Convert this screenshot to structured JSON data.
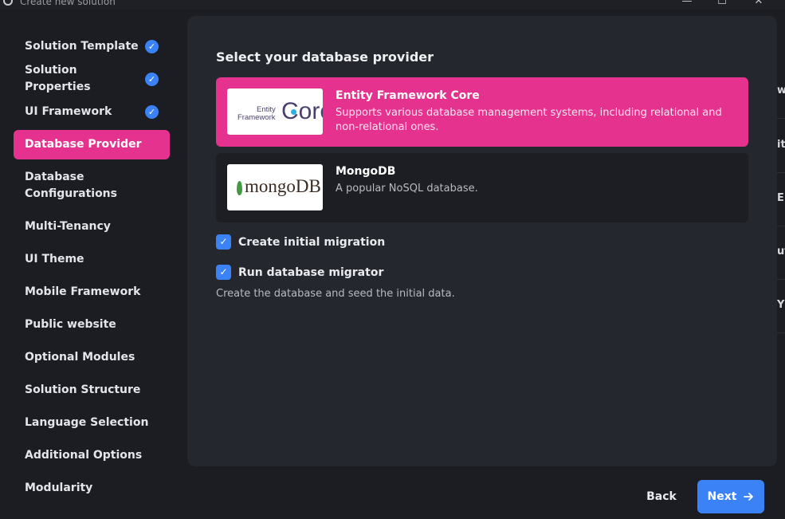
{
  "window": {
    "title": "Create new solution",
    "controls": {
      "minimize": "—",
      "maximize": "☐",
      "close": "✕"
    }
  },
  "sidebar": {
    "items": [
      {
        "label": "Solution Template",
        "completed": true
      },
      {
        "label": "Solution Properties",
        "completed": true
      },
      {
        "label": "UI Framework",
        "completed": true
      },
      {
        "label": "Database Provider",
        "active": true
      },
      {
        "label": "Database Configurations"
      },
      {
        "label": "Multi-Tenancy"
      },
      {
        "label": "UI Theme"
      },
      {
        "label": "Mobile Framework"
      },
      {
        "label": "Public website"
      },
      {
        "label": "Optional Modules"
      },
      {
        "label": "Solution Structure"
      },
      {
        "label": "Language Selection"
      },
      {
        "label": "Additional Options"
      },
      {
        "label": "Modularity"
      }
    ]
  },
  "main": {
    "title": "Select your database provider",
    "providers": [
      {
        "name": "Entity Framework Core",
        "description": "Supports various database management systems, including relational and non-relational ones.",
        "selected": true,
        "logo": {
          "line1": "Entity",
          "line2": "Framework",
          "core": "Core"
        }
      },
      {
        "name": "MongoDB",
        "description": "A popular NoSQL database.",
        "selected": false,
        "logo": {
          "text": "mongoDB"
        }
      }
    ],
    "options": [
      {
        "label": "Create initial migration",
        "checked": true
      },
      {
        "label": "Run database migrator",
        "checked": true
      }
    ],
    "hint": "Create the database and seed the initial data."
  },
  "edge_fragments": [
    "w",
    "ith",
    "E",
    "ut",
    "Y"
  ],
  "footer": {
    "back_label": "Back",
    "next_label": "Next",
    "next_icon": "arrow-right-icon"
  },
  "colors": {
    "accent": "#e5328f",
    "primary": "#3b82f6",
    "background": "#1b1d23",
    "panel": "#25272e"
  }
}
